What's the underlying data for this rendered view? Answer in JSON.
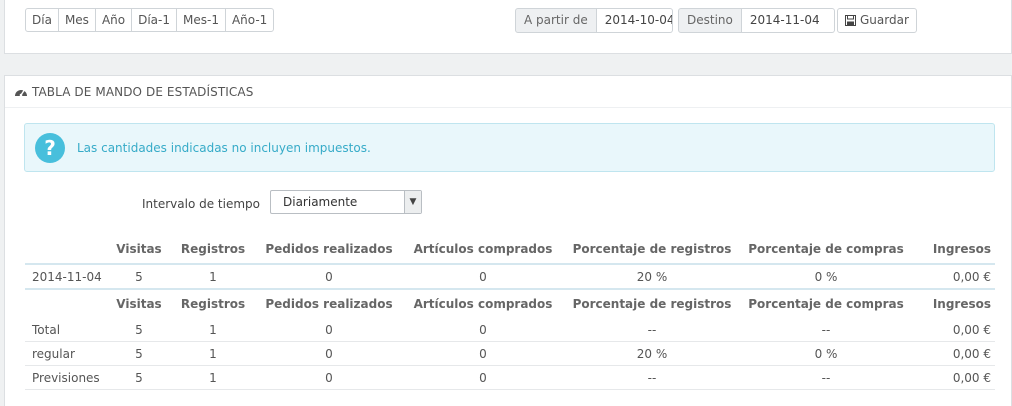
{
  "range_buttons": [
    "Día",
    "Mes",
    "Año",
    "Día-1",
    "Mes-1",
    "Año-1"
  ],
  "date_from": {
    "label": "A partir de",
    "value": "2014-10-04"
  },
  "date_to": {
    "label": "Destino",
    "value": "2014-11-04"
  },
  "save_label": "Guardar",
  "panel_title": "TABLA DE MANDO DE ESTADÍSTICAS",
  "alert_text": "Las cantidades indicadas no incluyen impuestos.",
  "interval": {
    "label": "Intervalo de tiempo",
    "selected": "Diariamente"
  },
  "headers": [
    "Visitas",
    "Registros",
    "Pedidos realizados",
    "Artículos comprados",
    "Porcentaje de registros",
    "Porcentaje de compras",
    "Ingresos"
  ],
  "daily_rows": [
    {
      "label": "2014-11-04",
      "cells": [
        "5",
        "1",
        "0",
        "0",
        "20 %",
        "0 %",
        "0,00 €"
      ]
    }
  ],
  "summary_rows": [
    {
      "label": "Total",
      "cells": [
        "5",
        "1",
        "0",
        "0",
        "--",
        "--",
        "0,00 €"
      ]
    },
    {
      "label": "regular",
      "cells": [
        "5",
        "1",
        "0",
        "0",
        "20 %",
        "0 %",
        "0,00 €"
      ]
    },
    {
      "label": "Previsiones",
      "cells": [
        "5",
        "1",
        "0",
        "0",
        "--",
        "--",
        "0,00 €"
      ]
    }
  ]
}
